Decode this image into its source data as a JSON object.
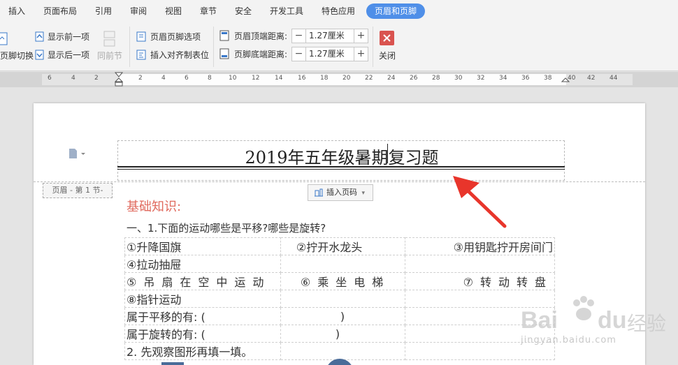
{
  "menu": {
    "tabs": [
      "插入",
      "页面布局",
      "引用",
      "审阅",
      "视图",
      "章节",
      "安全",
      "开发工具",
      "特色应用",
      "页眉和页脚"
    ]
  },
  "ribbon": {
    "switch_label": "页脚切换",
    "prev_label": "显示前一项",
    "next_label": "显示后一项",
    "same_as_prev_label": "同前节",
    "options_label": "页眉页脚选项",
    "insert_tab_label": "插入对齐制表位",
    "header_top_label": "页眉顶端距离:",
    "header_top_value": "1.27厘米",
    "footer_bottom_label": "页脚底端距离:",
    "footer_bottom_value": "1.27厘米",
    "close_label": "关闭"
  },
  "ruler": {
    "numbers": [
      "6",
      "4",
      "2",
      "2",
      "4",
      "6",
      "8",
      "10",
      "12",
      "14",
      "16",
      "18",
      "20",
      "22",
      "24",
      "26",
      "28",
      "30",
      "32",
      "34",
      "36",
      "38",
      "40",
      "42",
      "44"
    ]
  },
  "document": {
    "header_title": "2019年五年级暑期复习题",
    "header_label": "页眉 - 第 1 节-",
    "insert_page_number": "插入页码",
    "section_title": "基础知识:",
    "question": "一、1.下面的运动哪些是平移?哪些是旋转?",
    "rows": [
      [
        "①升降国旗",
        "②拧开水龙头",
        "③用钥匙拧开房间门"
      ],
      [
        "④拉动抽屉",
        "",
        ""
      ],
      [
        "⑤吊扇在空中运动",
        "⑥乘坐电梯",
        "⑦转动转盘"
      ],
      [
        "⑧指针运动",
        "",
        ""
      ],
      [
        "属于平移的有: (",
        ")",
        ""
      ],
      [
        "属于旋转的有: (",
        ")",
        ""
      ],
      [
        "2.  先观察图形再填一填。",
        "",
        ""
      ]
    ]
  },
  "watermark": {
    "brand": "Bai",
    "brand2": "du",
    "cn": "经验",
    "url": "jingyan.baidu.com"
  },
  "colors": {
    "active_tab": "#4f8fe8",
    "section_title": "#e06a5e",
    "arrow": "#e8352b",
    "close_button": "#d9534f"
  }
}
